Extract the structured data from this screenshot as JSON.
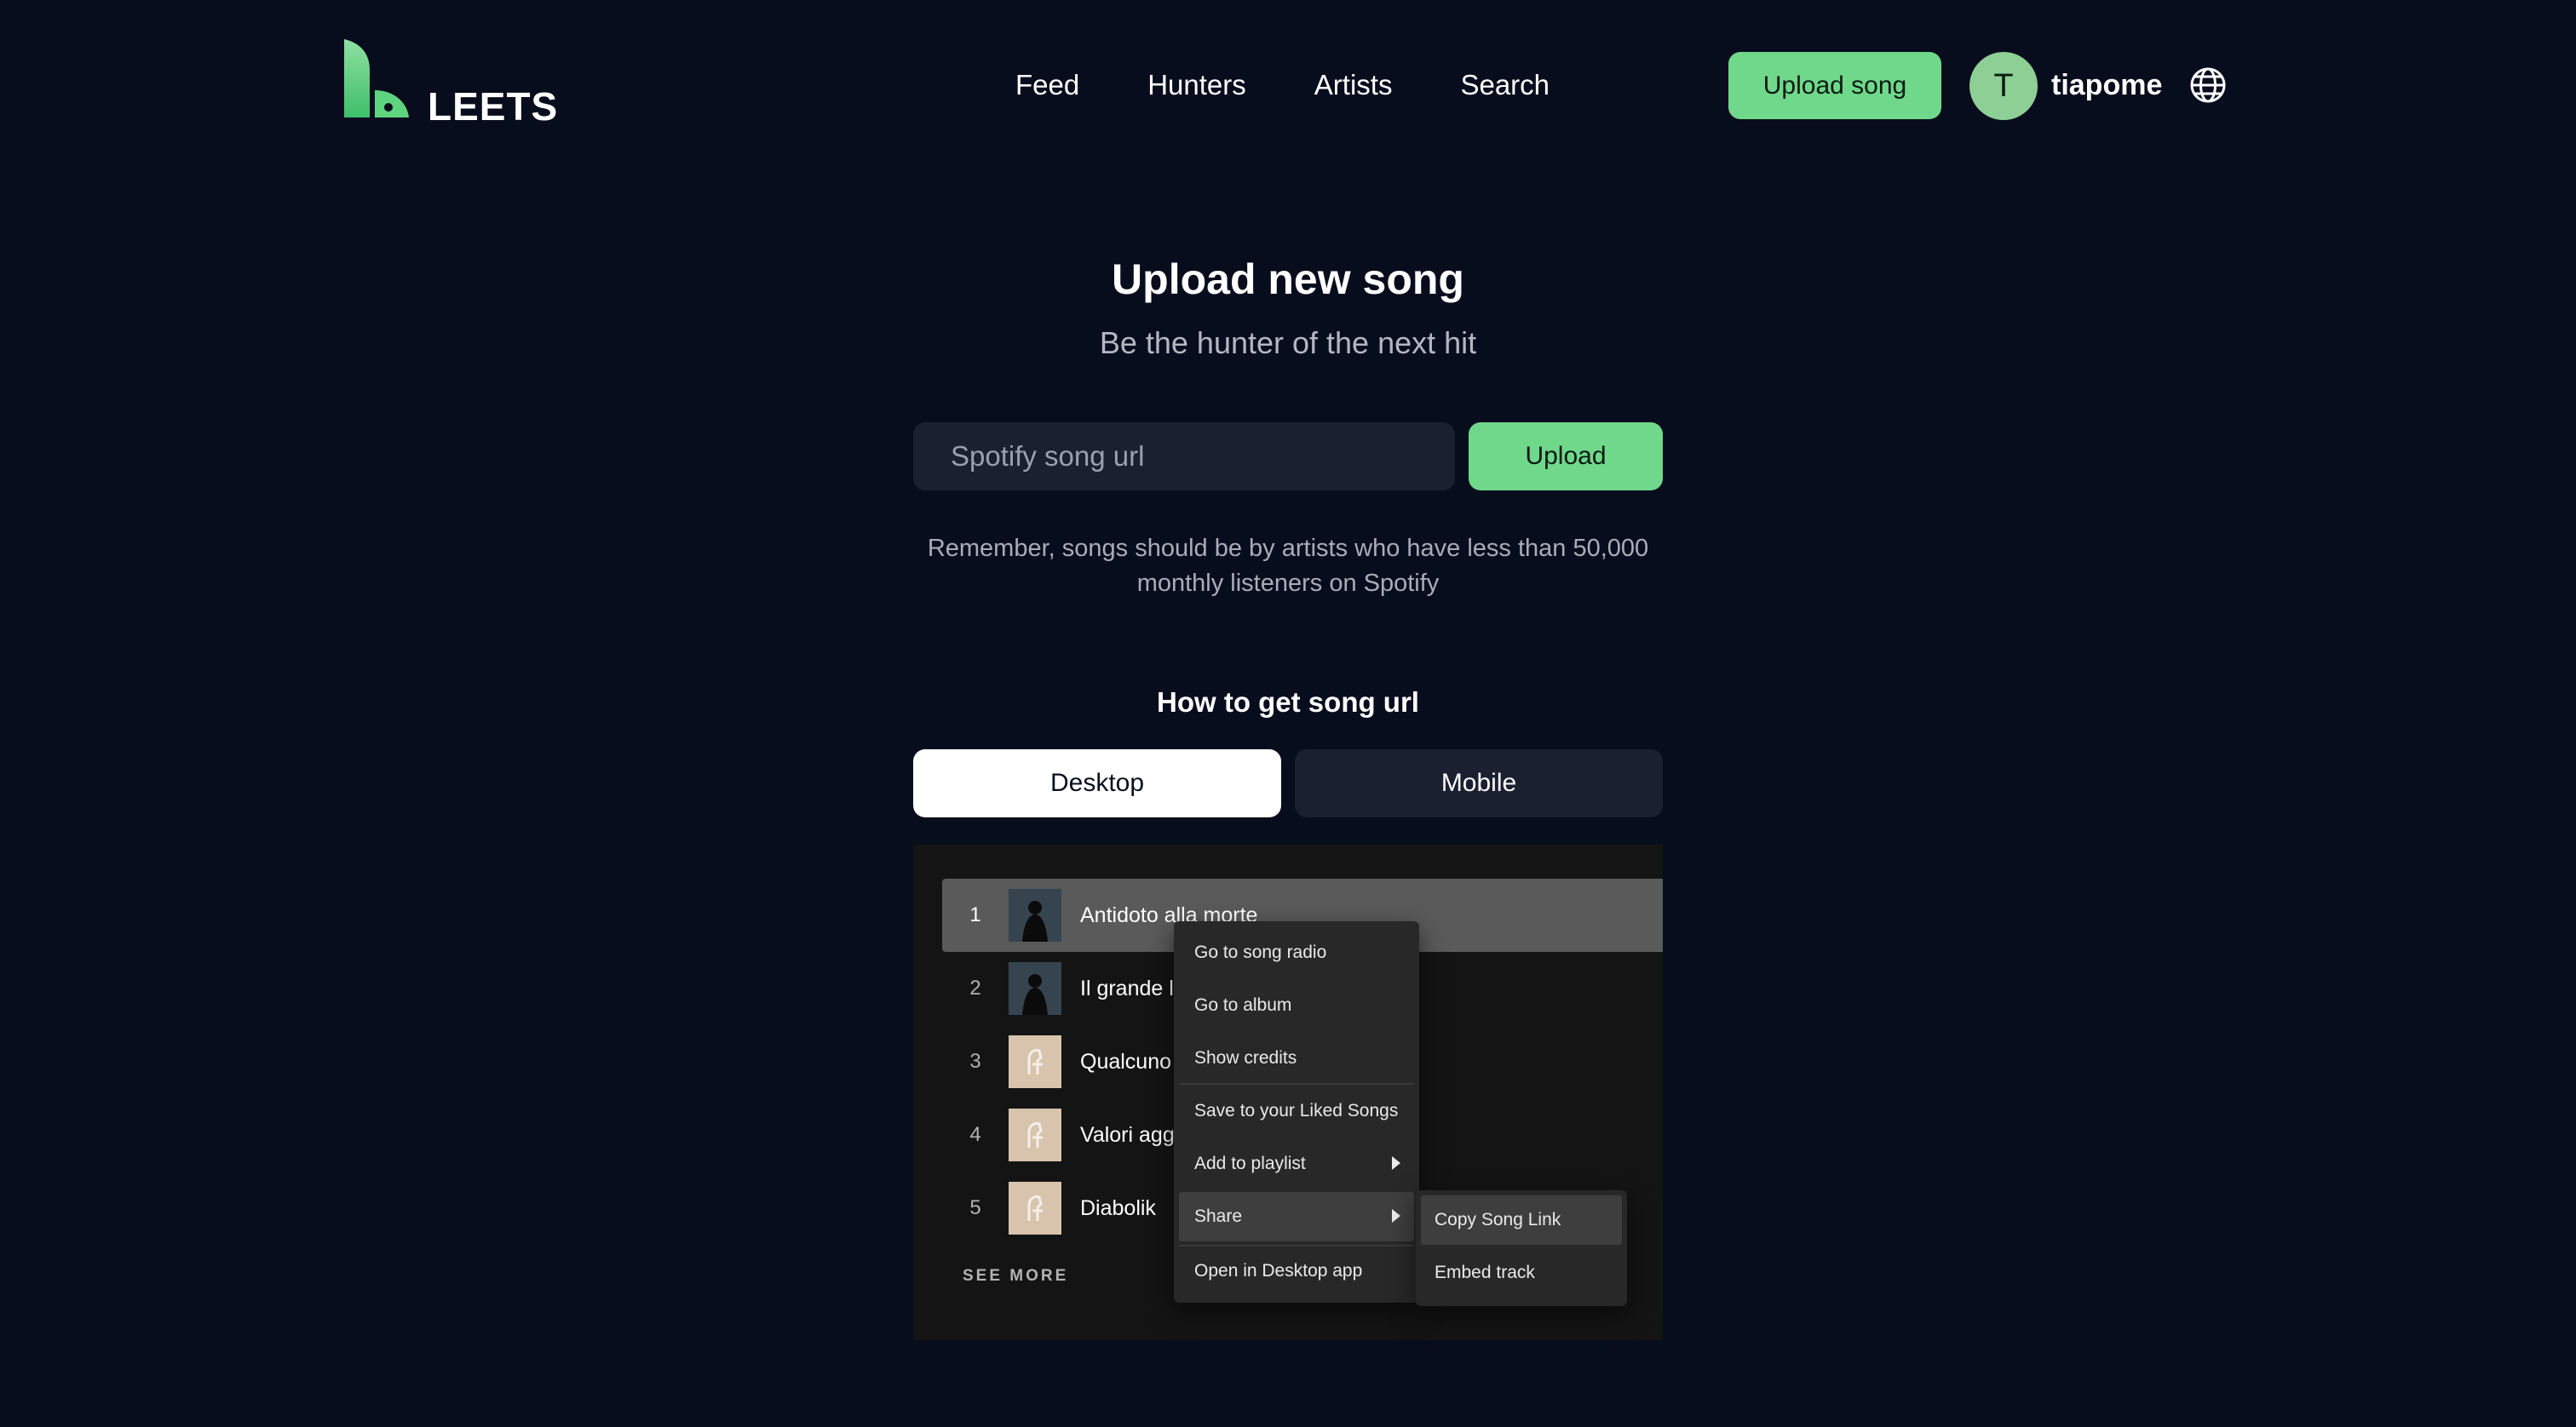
{
  "brand": {
    "name": "LEETS",
    "accent": "#6fd88b",
    "background": "#080d1d"
  },
  "nav": {
    "items": [
      "Feed",
      "Hunters",
      "Artists",
      "Search"
    ]
  },
  "header": {
    "upload_label": "Upload song",
    "avatar_initial": "T",
    "username": "tiapome",
    "language_icon": "globe-icon"
  },
  "main": {
    "title": "Upload new song",
    "subtitle": "Be the hunter of the next hit",
    "input_placeholder": "Spotify song url",
    "upload_label": "Upload",
    "hint": "Remember, songs should be by artists who have less than 50,000 monthly listeners on Spotify",
    "howto_title": "How to get song url",
    "tabs": [
      "Desktop",
      "Mobile"
    ],
    "active_tab": "Desktop"
  },
  "spotify": {
    "tracks": [
      {
        "number": "1",
        "title": "Antidoto alla morte"
      },
      {
        "number": "2",
        "title": "Il grande l"
      },
      {
        "number": "3",
        "title": "Qualcuno"
      },
      {
        "number": "4",
        "title": "Valori agg"
      },
      {
        "number": "5",
        "title": "Diabolik"
      }
    ],
    "see_more": "SEE MORE",
    "context_menu": [
      "Go to song radio",
      "Go to album",
      "Show credits",
      "Save to your Liked Songs",
      "Add to playlist",
      "Share",
      "Open in Desktop app"
    ],
    "share_menu": [
      "Copy Song Link",
      "Embed track"
    ]
  }
}
